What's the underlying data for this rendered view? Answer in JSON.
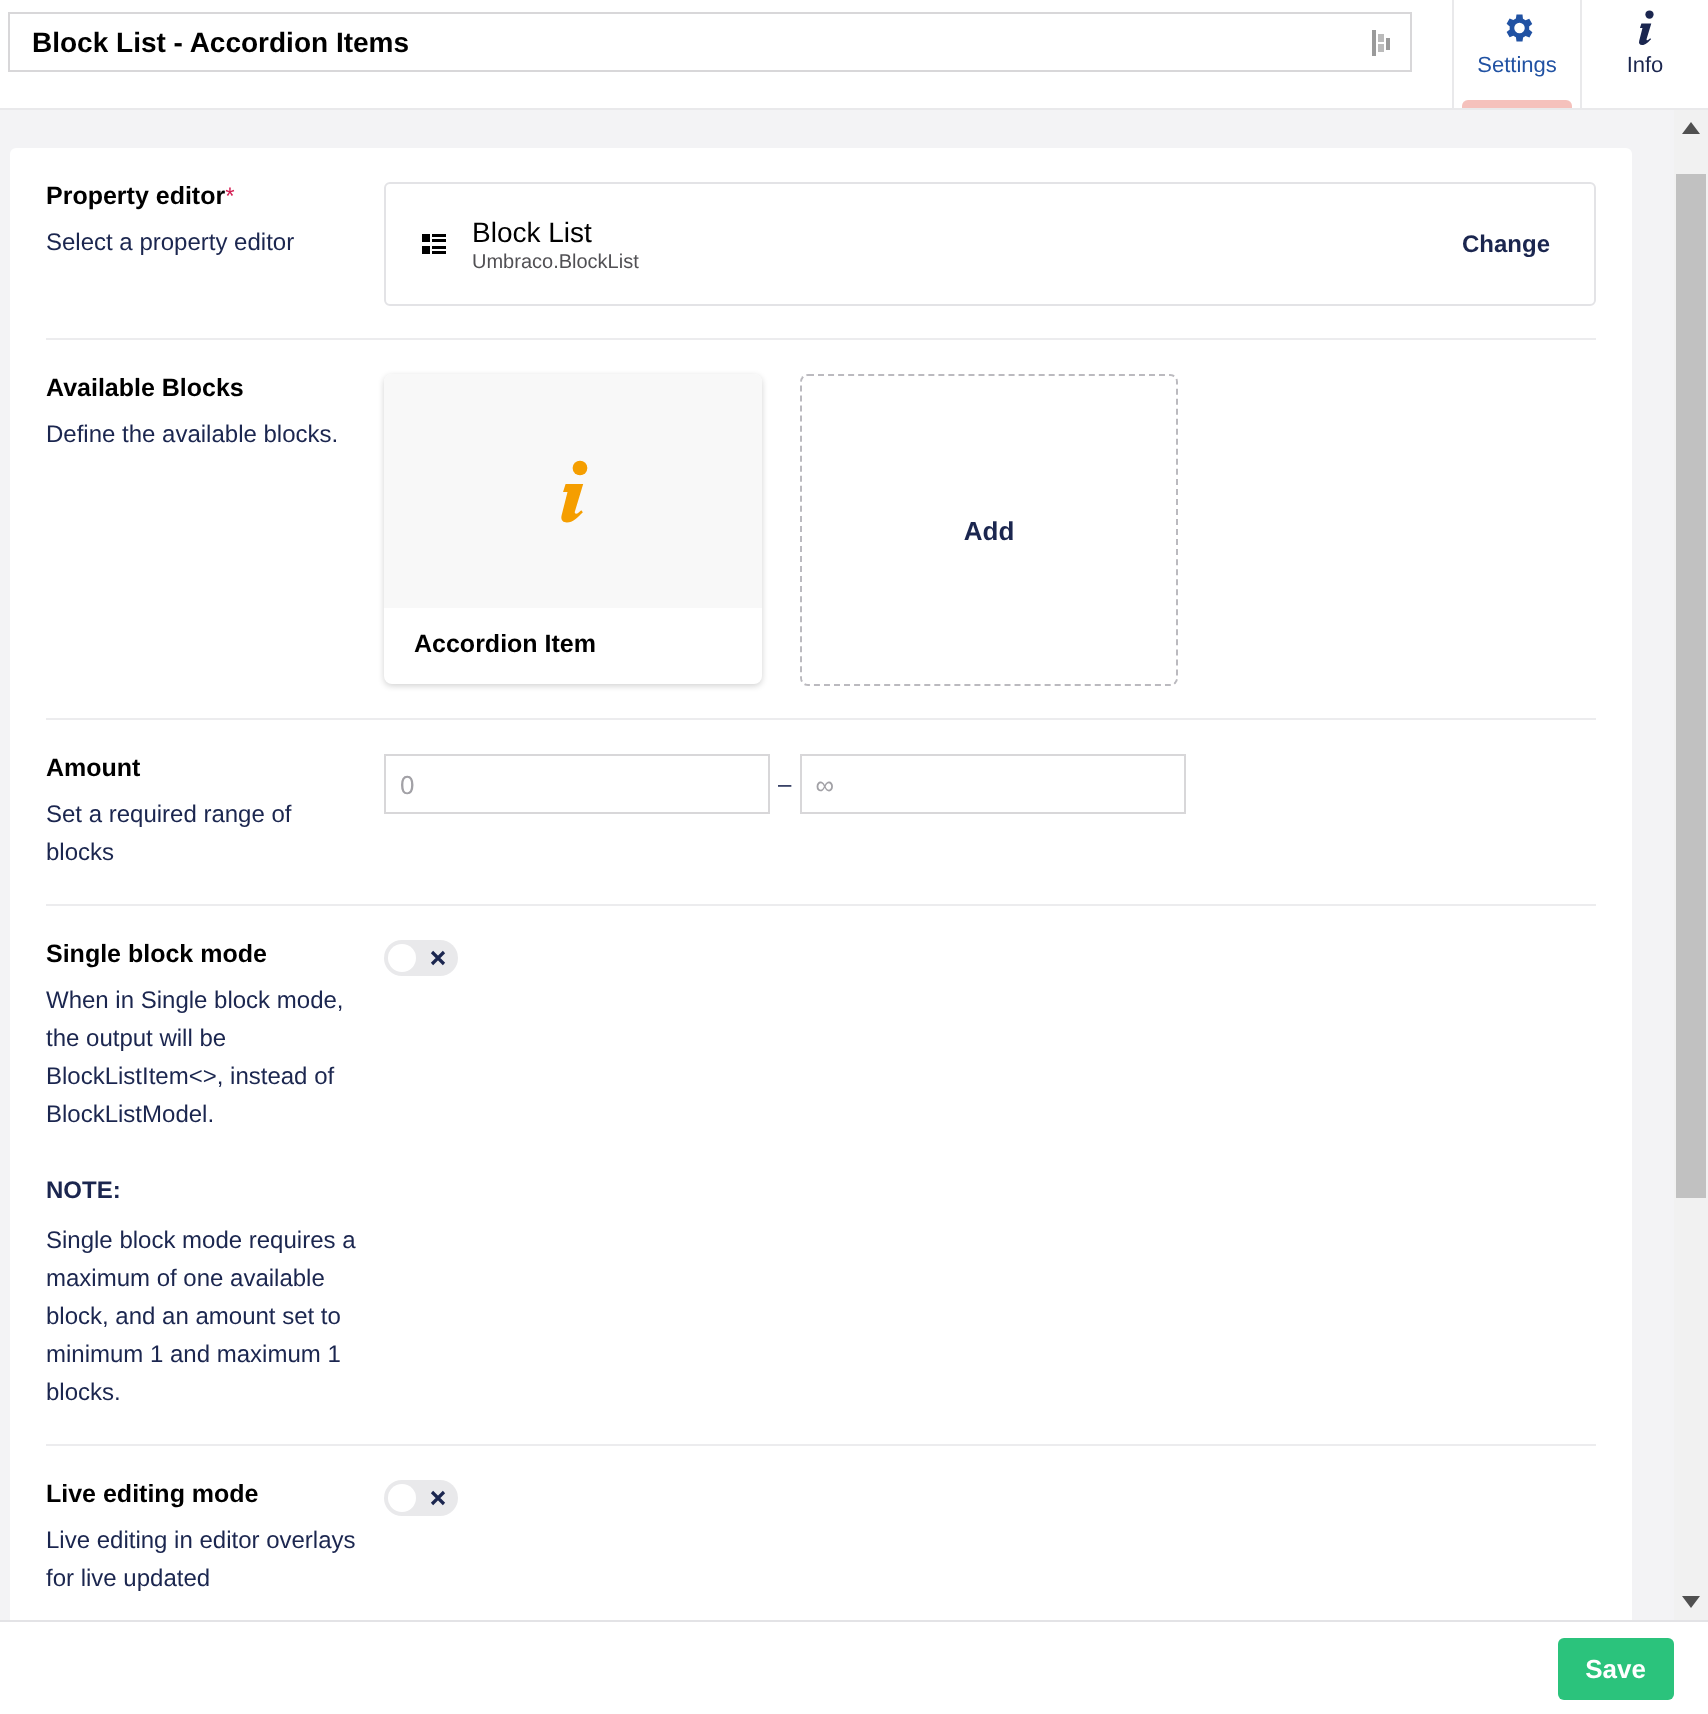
{
  "header": {
    "title": "Block List - Accordion Items",
    "tabs": [
      {
        "label": "Settings",
        "kind": "gear",
        "selected": true
      },
      {
        "label": "Info",
        "kind": "info",
        "selected": false
      }
    ]
  },
  "properties": [
    {
      "kind": "editor",
      "label": "Property editor",
      "required_mark": "*",
      "description": "Select a property editor",
      "editor": {
        "name": "Block List",
        "alias": "Umbraco.BlockList",
        "action": "Change"
      }
    },
    {
      "kind": "blocks",
      "label": "Available Blocks",
      "description": "Define the available blocks.",
      "blocks": [
        {
          "name": "Accordion Item"
        }
      ],
      "add_label": "Add"
    },
    {
      "kind": "range",
      "label": "Amount",
      "description": "Set a required range of blocks",
      "min": {
        "placeholder": "0"
      },
      "separator": "–",
      "max": {
        "placeholder": "∞"
      }
    },
    {
      "kind": "toggle",
      "label": "Single block mode",
      "on": false,
      "paragraphs": [
        {
          "kind": "plain",
          "text": "When in Single block mode, the output will be BlockListItem<>, instead of BlockListModel."
        },
        {
          "kind": "heading",
          "text": "NOTE:"
        },
        {
          "kind": "plain",
          "text": "Single block mode requires a maximum of one available block, and an amount set to minimum 1 and maximum 1 blocks."
        }
      ]
    },
    {
      "kind": "toggle",
      "label": "Live editing mode",
      "on": false,
      "paragraphs": [
        {
          "kind": "plain",
          "text": "Live editing in editor overlays for live updated"
        }
      ]
    }
  ],
  "footer": {
    "save": "Save"
  }
}
